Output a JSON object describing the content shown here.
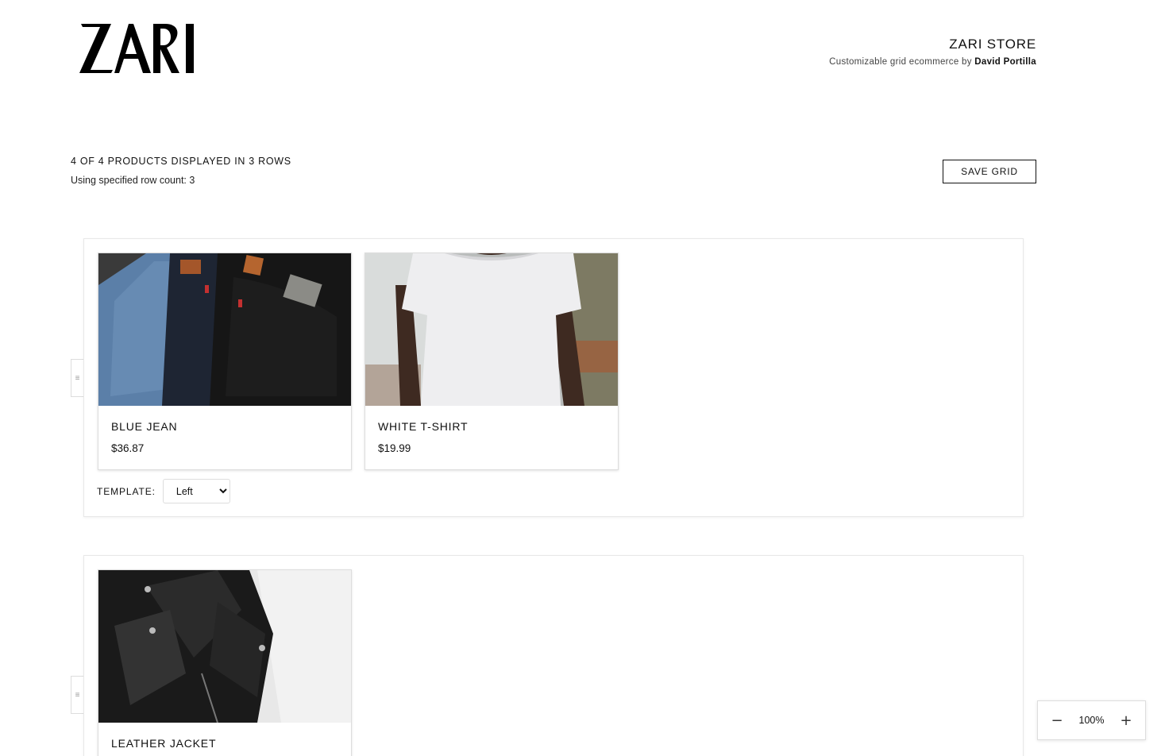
{
  "header": {
    "logo_text": "ZARI",
    "store_title": "ZARI STORE",
    "subtitle_prefix": "Customizable grid ecommerce by",
    "subtitle_author": "David Portilla"
  },
  "summary": {
    "count_text": "4 OF 4 PRODUCTS DISPLAYED IN 3 ROWS",
    "row_count_text": "Using specified row count: 3"
  },
  "toolbar": {
    "save_label": "SAVE GRID"
  },
  "rows": [
    {
      "products": [
        {
          "name": "BLUE JEAN",
          "price": "$36.87",
          "image": "jeans-photo"
        },
        {
          "name": "WHITE T-SHIRT",
          "price": "$19.99",
          "image": "tshirt-photo"
        }
      ],
      "template_label": "TEMPLATE:",
      "template_value": "Left"
    },
    {
      "products": [
        {
          "name": "LEATHER JACKET",
          "image": "jacket-photo"
        }
      ]
    }
  ],
  "drag_handle_icon": "drag-handle-icon",
  "zoom": {
    "minus": "−",
    "value": "100%",
    "plus": "+"
  }
}
